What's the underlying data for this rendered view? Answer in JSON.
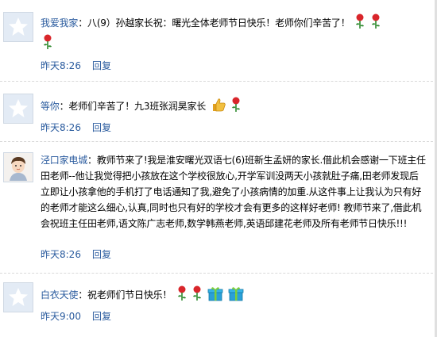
{
  "comments": [
    {
      "user": "我爱我家",
      "sep": "：",
      "text": "八(9）孙越家长祝：曙光全体老师节日快乐！老师你们辛苦了！",
      "time": "昨天8:26",
      "reply": "回复",
      "icons": [
        "rose-icon",
        "rose-icon",
        "rose-icon"
      ]
    },
    {
      "user": "等你",
      "sep": "：",
      "text": "老师们辛苦了！九3班张润昊家长",
      "time": "昨天8:26",
      "reply": "回复",
      "icons": [
        "thumbs-up-icon",
        "rose-icon"
      ]
    },
    {
      "user": "泾口家电城",
      "sep": "：",
      "text": "教师节来了!我是淮安曙光双语七(6)班新生孟妍的家长.借此机会感谢一下班主任田老师--他让我觉得把小孩放在这个学校很放心,开学军训没两天小孩就肚子痛,田老师发现后立即让小孩拿他的手机打了电话通知了我,避免了小孩病情的加重.从这件事上让我认为只有好的老师才能这么细心,认真,同时也只有好的学校才会有更多的这样好老师! 教师节来了,借此机会祝班主任田老师,语文陈广志老师,数学韩燕老师,英语邱建花老师及所有老师节日快乐!!!",
      "time": "昨天8:26",
      "reply": "回复",
      "icons": []
    },
    {
      "user": "白衣天使",
      "sep": "：",
      "text": "祝老师们节日快乐！",
      "time": "昨天9:00",
      "reply": "回复",
      "icons": [
        "rose-icon",
        "rose-icon",
        "gift-icon",
        "gift-icon"
      ]
    }
  ],
  "colors": {
    "link": "#2a5b9e",
    "divider": "#d9d9d9",
    "avatar_bg": "#e3ebf5"
  }
}
